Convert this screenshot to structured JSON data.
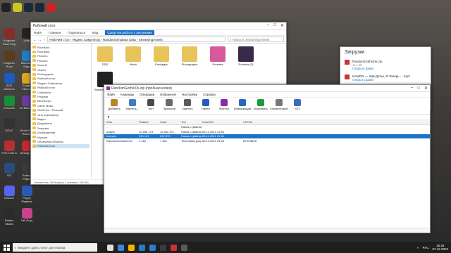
{
  "desktop": {
    "col1": [
      {
        "label": "Kingdom Rush Orig",
        "color": "#8a2b2b"
      },
      {
        "label": "Kingdom Rush Frontiers",
        "color": "#5d3a1a"
      },
      {
        "label": "AVG Antivirus",
        "color": "#1d5bbf"
      },
      {
        "label": "CCleaner",
        "color": "#1b8e3b"
      },
      {
        "label": "DOLC",
        "color": "#333333"
      },
      {
        "label": "Free Cam 8",
        "color": "#b53030"
      },
      {
        "label": "GO",
        "color": "#2b4b7a"
      },
      {
        "label": "Discord",
        "color": "#5865f2"
      },
      {
        "label": "Roblox Studio",
        "color": "#2b2b2b"
      }
    ],
    "col2": [
      {
        "label": "Unity",
        "color": "#222222"
      },
      {
        "label": "Microsoft Edge",
        "color": "#1d7ec4"
      },
      {
        "label": "Google Chrome",
        "color": "#dba31f"
      },
      {
        "label": "Tor Browser",
        "color": "#6c3a9e"
      },
      {
        "label": "World War Heroes",
        "color": "#3a3a3a"
      },
      {
        "label": "Among Us",
        "color": "#c0282d"
      },
      {
        "label": "Roblox Player",
        "color": "#3a3a3a"
      },
      {
        "label": "Poppy Playtime",
        "color": "#2a5ab5"
      },
      {
        "label": "Fall Guys",
        "color": "#c9428a"
      }
    ],
    "top_icons": [
      {
        "label": "Unity Hub",
        "color": "#222"
      },
      {
        "label": "ReLive",
        "color": "#c8c820"
      },
      {
        "label": "Steam",
        "color": "#1b2838"
      },
      {
        "label": "Steam",
        "color": "#1b2838"
      },
      {
        "label": "K",
        "color": "#cc2222"
      }
    ]
  },
  "explorer": {
    "title": "Рабочий стол",
    "ribbon_tabs": [
      "Файл",
      "Главная",
      "Поделиться",
      "Вид"
    ],
    "ribbon_active": "Средства работы с рисунками",
    "path": "Рабочий стол › Яндекс Симулятор › RandomSimulator Data › StreamingAssets",
    "search_placeholder": "Поиск в: StreamingAssets",
    "nav": [
      "RoonMod",
      "RoonMod",
      "Pictures",
      "Pictures",
      "Sounds",
      "Videos",
      "Photographs",
      "Рабочий стол",
      "Яндекс Симулятор",
      "Рабочий стол",
      "Collections",
      "Рисунки",
      "MineScript",
      "Game Music",
      "OneDrive - Personal",
      "Этот компьютер",
      "Видео",
      "Документы",
      "Загрузки",
      "Изображения",
      "Музыка",
      "Объемные объекты",
      "Рабочий стол"
    ],
    "tiles": [
      {
        "label": "DDS",
        "color": "#e8c35a"
      },
      {
        "label": "Music",
        "color": "#e8c35a"
      },
      {
        "label": "Packages",
        "color": "#e8c35a"
      },
      {
        "label": "Photographs",
        "color": "#e8c35a"
      },
      {
        "label": "Portraits",
        "color": "#d45a9a"
      },
      {
        "label": "Portraits (2)",
        "color": "#3a2a4a"
      },
      {
        "label": "StreamingAssets",
        "color": "#222222"
      }
    ],
    "status": "Элементов: 38   Выбран 1 элемент: 250 КБ"
  },
  "notif": {
    "title": "Загрузки",
    "items": [
      {
        "name": "RandomGothicDs.zip",
        "sub": "10.7 КБ",
        "action": "Открыть файл"
      },
      {
        "name": "KAMON — Хай Детка, Я Теперь ....mp3",
        "sub": "",
        "action": "Открыть файл"
      }
    ]
  },
  "archive": {
    "title": "RandomGothicDs.zip (пробная копия)",
    "menu": [
      "Файл",
      "Команды",
      "Операции",
      "Избранное",
      "Настройки",
      "Справка"
    ],
    "tools": [
      {
        "label": "Добавить",
        "color": "#b8862b"
      },
      {
        "label": "Извлечь...",
        "color": "#3e7dc4"
      },
      {
        "label": "Тест",
        "color": "#4a4a4a"
      },
      {
        "label": "Просмотр",
        "color": "#6a6a6a"
      },
      {
        "label": "Удалить",
        "color": "#5a5a5a"
      },
      {
        "label": "Найти",
        "color": "#2b5cb5"
      },
      {
        "label": "Мастер",
        "color": "#8a2ba8"
      },
      {
        "label": "Информация",
        "color": "#2a6ab5"
      },
      {
        "label": "Исправить",
        "color": "#1d9a3a"
      },
      {
        "label": "Комментарий",
        "color": "#777777"
      },
      {
        "label": "SFX",
        "color": "#3d6abf"
      }
    ],
    "headers": [
      "Имя",
      "Размер",
      "Сжат",
      "Тип",
      "Изменён",
      "CRC32"
    ],
    "rows": [
      {
        "name": "..",
        "size": "",
        "packed": "",
        "type": "Папка с файлами",
        "modified": "",
        "crc": "",
        "selected": false
      },
      {
        "name": "unityfo",
        "size": "10 556 174",
        "packed": "10 552 471",
        "type": "Папка с файлами",
        "modified": "05.11.2021 21:56",
        "crc": "",
        "selected": false
      },
      {
        "name": "textures",
        "size": "225 191",
        "packed": "222 373",
        "type": "Папка с файлами",
        "modified": "05.11.2021 21:56",
        "crc": "",
        "selected": true
      },
      {
        "name": "RandomGothicDs.txt",
        "size": "1 416",
        "packed": "7 361",
        "type": "Текстовый доку...",
        "modified": "05.11.2021 21:53",
        "crc": "B7093BCE",
        "selected": false
      }
    ]
  },
  "taskbar": {
    "search_placeholder": "Введите здесь текст для поиска",
    "apps": [
      "#e0e0e0",
      "#3a87d9",
      "#f4b400",
      "#1d7ec4",
      "#2b7cd3",
      "#3a3a3a",
      "#c33",
      "#5a5a5a"
    ],
    "lang": "РУС",
    "time": "16:26",
    "date": "07.12.2022"
  }
}
